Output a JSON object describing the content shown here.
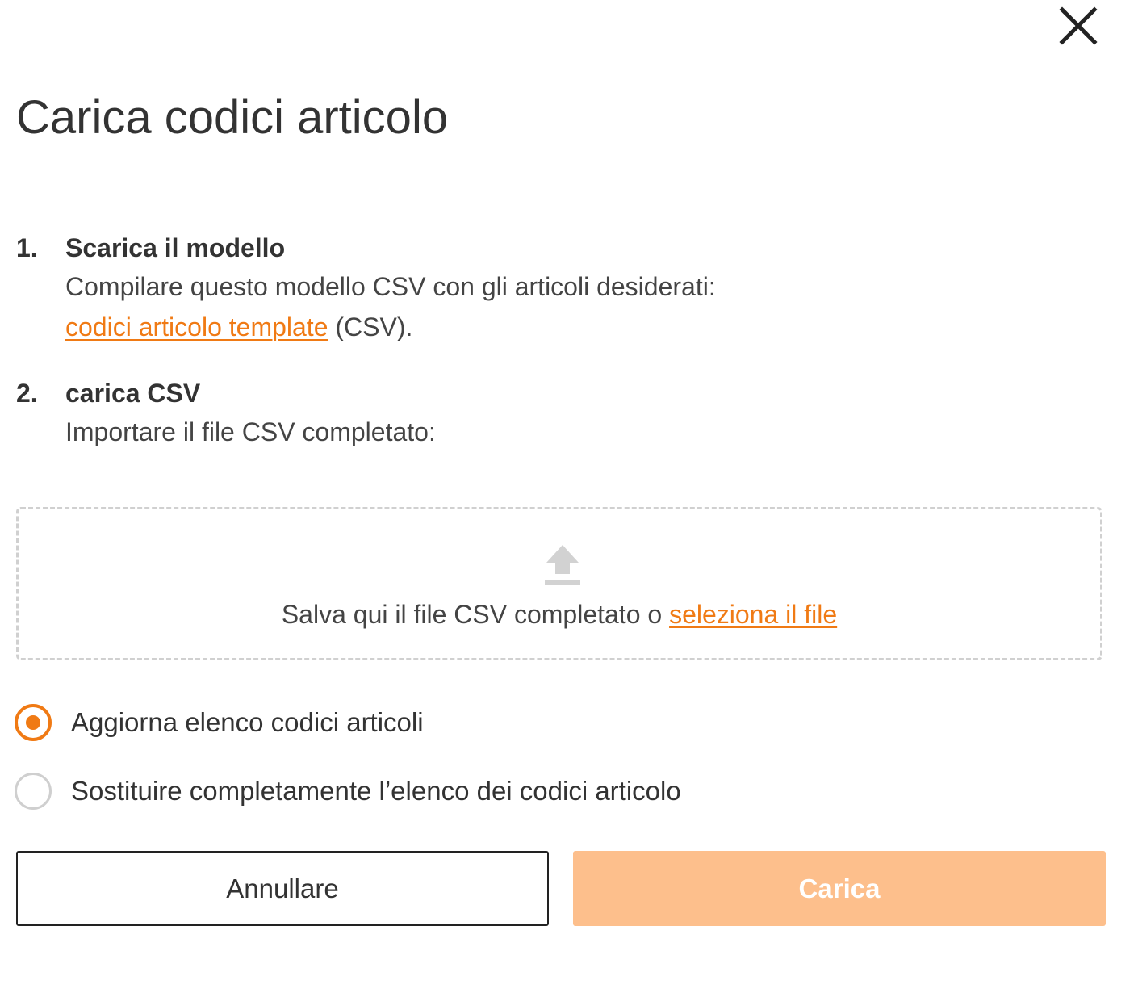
{
  "dialog": {
    "title": "Carica codici articolo",
    "close_icon": "close-icon"
  },
  "steps": [
    {
      "number": "1.",
      "title": "Scarica il modello",
      "text": "Compilare questo modello CSV con gli articoli desiderati:",
      "link_text": "codici articolo template",
      "link_suffix": " (CSV)."
    },
    {
      "number": "2.",
      "title": "carica CSV",
      "text": "Importare il file CSV completato:"
    }
  ],
  "dropzone": {
    "icon": "upload-icon",
    "text": "Salva qui il file CSV completato o ",
    "link_text": "seleziona il file"
  },
  "options": [
    {
      "label": "Aggiorna elenco codici articoli",
      "selected": true
    },
    {
      "label": "Sostituire completamente l’elenco dei codici articolo",
      "selected": false
    }
  ],
  "buttons": {
    "cancel_label": "Annullare",
    "upload_label": "Carica",
    "upload_enabled": false
  },
  "colors": {
    "accent": "#f07a14",
    "accent_disabled": "#fdbf8c",
    "text": "#333333"
  }
}
